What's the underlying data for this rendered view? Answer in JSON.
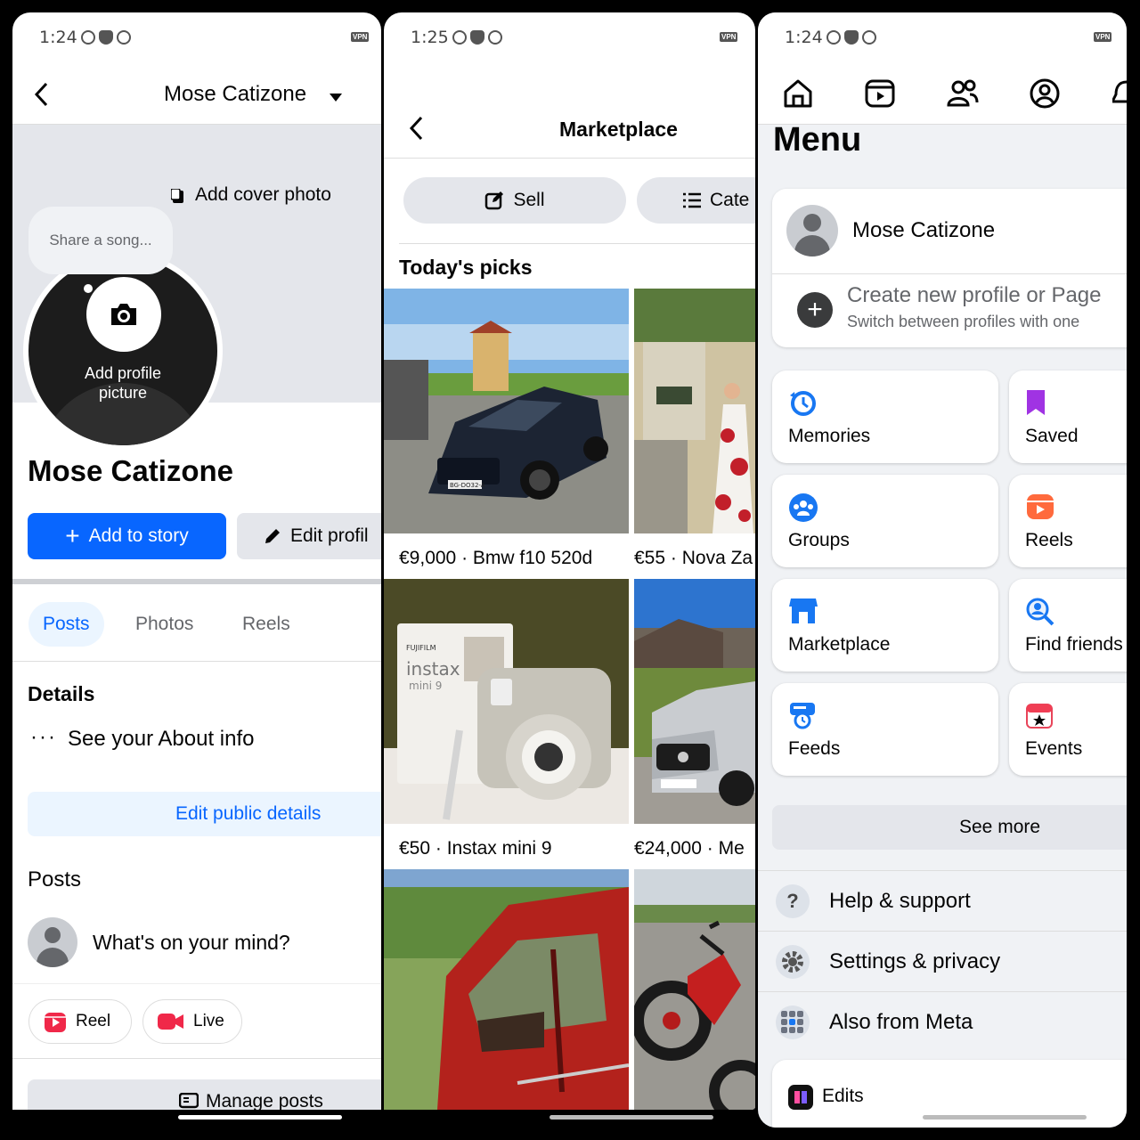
{
  "panel1": {
    "status_time": "1:24",
    "vpn": "VPN",
    "header_name": "Mose Catizone",
    "add_cover": "Add cover photo",
    "song_bubble": "Share a song...",
    "add_profile_picture": "Add profile picture",
    "profile_name": "Mose Catizone",
    "add_story": "Add to story",
    "edit_profile": "Edit profil",
    "tabs": [
      "Posts",
      "Photos",
      "Reels"
    ],
    "details_heading": "Details",
    "about_info": "See your About info",
    "edit_public_details": "Edit public details",
    "posts_heading": "Posts",
    "composer_placeholder": "What's on your mind?",
    "reel": "Reel",
    "live": "Live",
    "manage_posts": "Manage posts"
  },
  "panel2": {
    "status_time": "1:25",
    "vpn": "VPN",
    "title": "Marketplace",
    "sell": "Sell",
    "categories": "Cate",
    "todays_picks": "Today's picks",
    "listings": [
      {
        "price": "€9,000",
        "title": "Bmw f10 520d"
      },
      {
        "price": "€55",
        "title": "Nova Za"
      },
      {
        "price": "€50",
        "title": "Instax mini 9"
      },
      {
        "price": "€24,000",
        "title": "Me"
      }
    ],
    "photo_labels": {
      "instax": "instax",
      "mini": "mini 9",
      "fujifilm": "FUJIFILM",
      "plate": "BG-DO32-A"
    }
  },
  "panel3": {
    "status_time": "1:24",
    "vpn": "VPN",
    "menu_title": "Menu",
    "profile_name": "Mose Catizone",
    "create_title": "Create new profile or Page",
    "create_sub": "Switch between profiles with one",
    "shortcuts": [
      {
        "label": "Memories",
        "icon": "memories-icon"
      },
      {
        "label": "Saved",
        "icon": "saved-icon"
      },
      {
        "label": "Groups",
        "icon": "groups-icon"
      },
      {
        "label": "Reels",
        "icon": "reels-icon"
      },
      {
        "label": "Marketplace",
        "icon": "marketplace-icon"
      },
      {
        "label": "Find friends",
        "icon": "find-friends-icon"
      },
      {
        "label": "Feeds",
        "icon": "feeds-icon"
      },
      {
        "label": "Events",
        "icon": "events-icon"
      }
    ],
    "see_more": "See more",
    "help": "Help & support",
    "settings": "Settings & privacy",
    "meta": "Also from Meta",
    "edits": "Edits"
  },
  "colors": {
    "accent": "#0866ff",
    "bg_grey": "#f0f2f5",
    "chip": "#e4e6eb"
  }
}
